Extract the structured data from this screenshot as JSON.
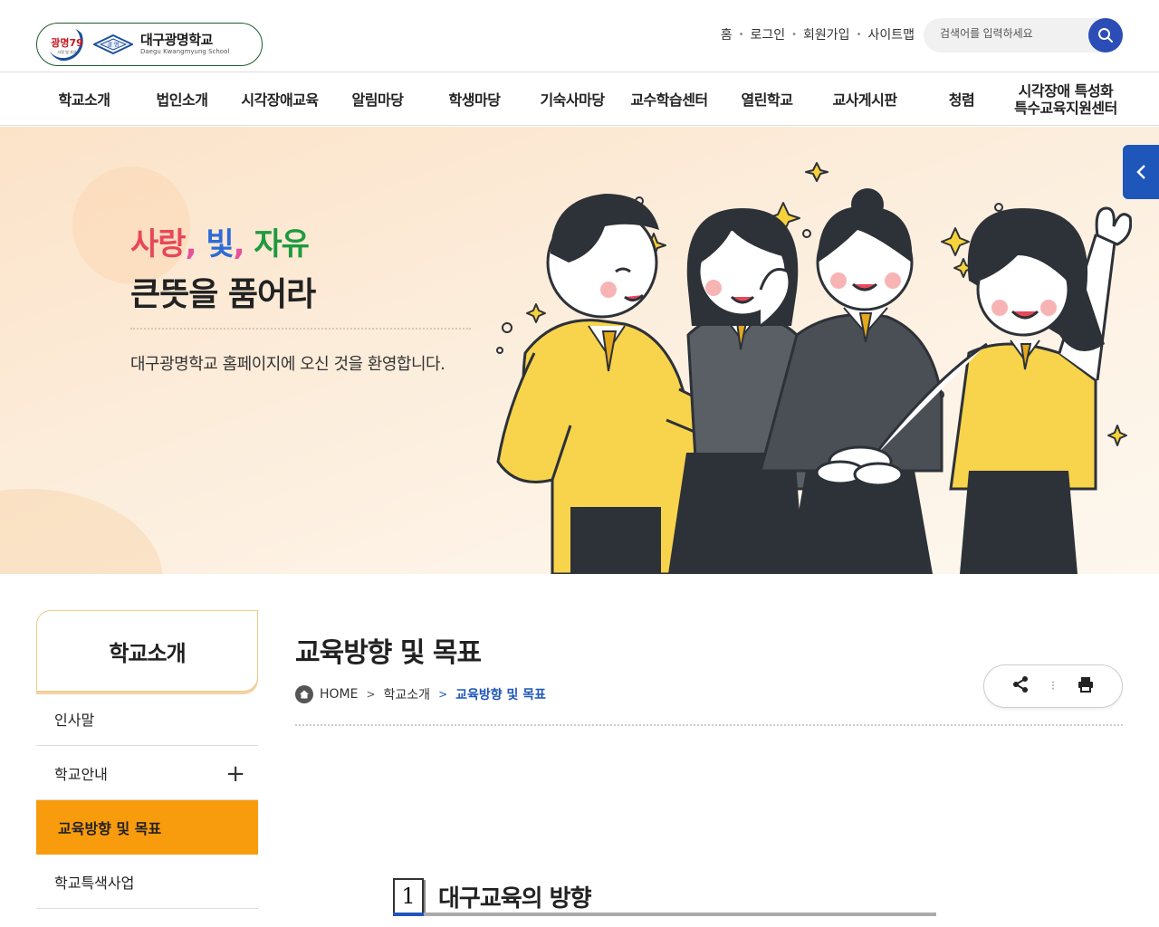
{
  "header": {
    "logo_badge": "광명79",
    "logo_badge_sub": "사랑 빛 자유",
    "logo_mark": "광 명",
    "school_name": "대구광명학교",
    "school_name_en": "Daegu Kwangmyung School",
    "util_links": [
      "홈",
      "로그인",
      "회원가입",
      "사이트맵"
    ],
    "search_placeholder": "검색어를 입력하세요"
  },
  "gnb": {
    "items": [
      "학교소개",
      "법인소개",
      "시각장애교육",
      "알림마당",
      "학생마당",
      "기숙사마당",
      "교수학습센터",
      "열린학교",
      "교사게시판",
      "청렴",
      "시각장애 특성화\n특수교육지원센터"
    ]
  },
  "hero": {
    "word1": "사랑",
    "word2": "빛",
    "word3": "자유",
    "comma": ",",
    "title2": "큰뜻을 품어라",
    "subtitle": "대구광명학교 홈페이지에 오신 것을 환영합니다."
  },
  "lnb": {
    "title": "학교소개",
    "items": [
      {
        "label": "인사말",
        "active": false,
        "expandable": false
      },
      {
        "label": "학교안내",
        "active": false,
        "expandable": true
      },
      {
        "label": "교육방향 및 목표",
        "active": true,
        "expandable": false
      },
      {
        "label": "학교특색사업",
        "active": false,
        "expandable": false
      }
    ],
    "expand_symbol": "+"
  },
  "content": {
    "page_title": "교육방향 및 목표",
    "breadcrumb": [
      "HOME",
      "학교소개",
      "교육방향 및 목표"
    ],
    "section_number": "1",
    "section_title": "대구교육의  방향"
  },
  "colors": {
    "accent_blue": "#1e56b9",
    "active_orange": "#f89c0e",
    "search_blue": "#2b4db5"
  },
  "icons": [
    "search-icon",
    "chevron-left-icon",
    "home-icon",
    "share-icon",
    "print-icon"
  ]
}
